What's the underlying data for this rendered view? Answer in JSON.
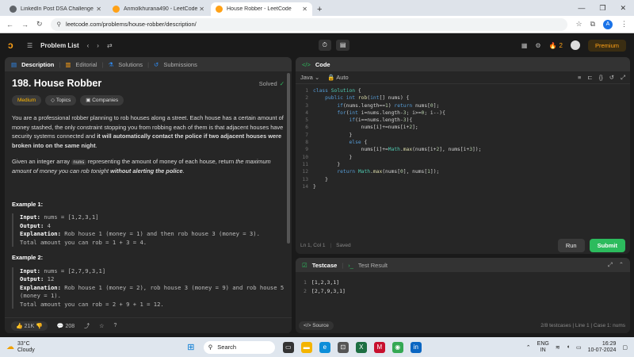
{
  "browser": {
    "tabs": [
      {
        "title": "LinkedIn Post DSA Challenge",
        "color": "#5f6368"
      },
      {
        "title": "Anmolkhurana490 - LeetCode",
        "color": "#ffa116"
      },
      {
        "title": "House Robber - LeetCode",
        "color": "#ffa116"
      }
    ],
    "new_tab": "+",
    "url": "leetcode.com/problems/house-robber/description/",
    "profile_letter": "A"
  },
  "nav": {
    "problem_list": "Problem List",
    "streak": "2",
    "premium": "Premium"
  },
  "left": {
    "tabs": [
      "Description",
      "Editorial",
      "Solutions",
      "Submissions"
    ],
    "title": "198. House Robber",
    "solved": "Solved",
    "chips": [
      "Medium",
      "Topics",
      "Companies"
    ],
    "para1": "You are a professional robber planning to rob houses along a street. Each house has a certain amount of money stashed, the only constraint stopping you from robbing each of them is that adjacent houses have security systems connected and",
    "para1_bold": "it will automatically contact the police if two adjacent houses were broken into on the same night",
    "para2_a": "Given an integer array",
    "para2_code": "nums",
    "para2_b": "representing the amount of money of each house, return",
    "para2_c": "the maximum amount of money you can rob tonight",
    "para2_d": "without alerting the police",
    "examples": [
      {
        "heading": "Example 1:",
        "input": "nums = [1,2,3,1]",
        "output": "4",
        "explanation": "Rob house 1 (money = 1) and then rob house 3 (money = 3).",
        "total": "Total amount you can rob = 1 + 3 = 4."
      },
      {
        "heading": "Example 2:",
        "input": "nums = [2,7,9,3,1]",
        "output": "12",
        "explanation": "Rob house 1 (money = 2), rob house 3 (money = 9) and rob house 5 (money = 1).",
        "total": "Total amount you can rob = 2 + 9 + 1 = 12."
      }
    ],
    "labels": {
      "input": "Input:",
      "output": "Output:",
      "explanation": "Explanation:"
    },
    "likes": "21K",
    "comments": "208"
  },
  "code": {
    "header": "Code",
    "language": "Java",
    "mode": "Auto",
    "status": "Ln 1, Col 1",
    "saved": "Saved",
    "run": "Run",
    "submit": "Submit"
  },
  "testcase": {
    "tab1": "Testcase",
    "tab2": "Test Result",
    "cases": [
      "[1,2,3,1]",
      "[2,7,9,3,1]"
    ],
    "source": "Source",
    "footer": "2/8 testcases | Line 1 | Case 1: nums"
  },
  "taskbar": {
    "temp": "33°C",
    "weather": "Cloudy",
    "search": "Search",
    "lang": "ENG",
    "region": "IN",
    "time": "16:29",
    "date": "10-07-2024"
  }
}
